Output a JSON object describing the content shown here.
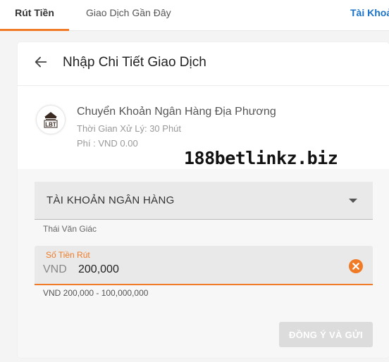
{
  "topnav": {
    "tabs": [
      "Rút Tiền",
      "Giao Dịch Gần Đây",
      "Tài Khoả"
    ]
  },
  "card": {
    "title": "Nhập Chi Tiết Giao Dịch"
  },
  "method": {
    "logo_text": "LBT",
    "name": "Chuyển Khoản Ngân Hàng Địa Phương",
    "processing_time": "Thời Gian Xử Lý: 30 Phút",
    "fee": "Phí : VND 0.00"
  },
  "watermark": "188betlinkz.biz",
  "bank_account": {
    "label": "TÀI KHOẢN NGÂN HÀNG",
    "holder_name": "Thái Văn Giác"
  },
  "amount": {
    "label": "Số Tiền Rút",
    "currency": "VND",
    "value": "200,000",
    "range_hint": "VND 200,000 - 100,000,000"
  },
  "submit": {
    "label": "ĐỒNG Ý VÀ GỬI"
  },
  "colors": {
    "accent": "#f07a26",
    "link": "#1a73c8",
    "disabled_button": "#dcdcdc"
  }
}
